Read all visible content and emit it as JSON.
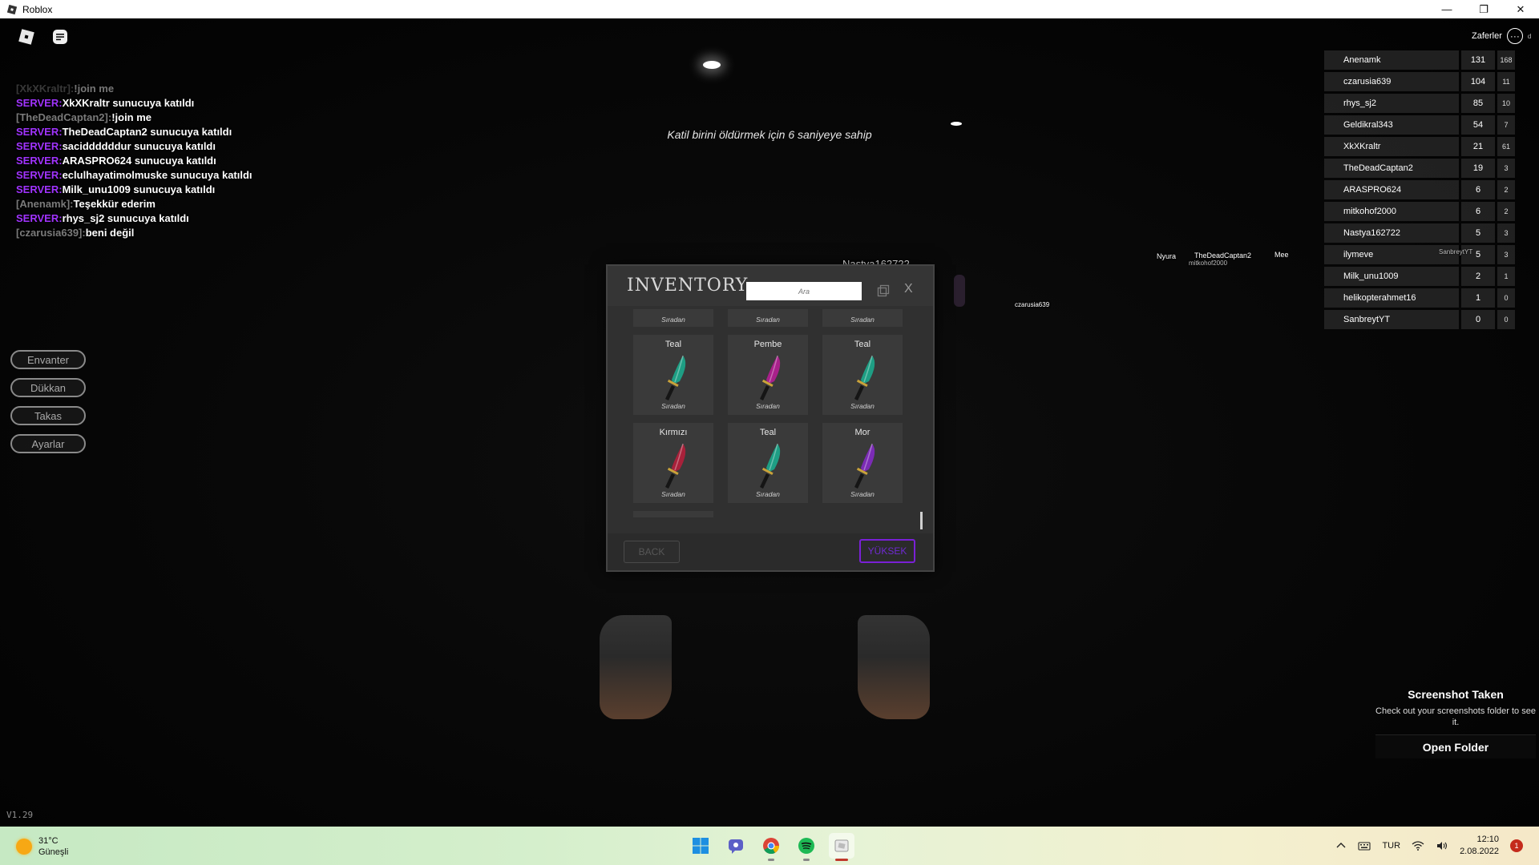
{
  "window": {
    "title": "Roblox",
    "minimize": "—",
    "restore": "❐",
    "close": "✕"
  },
  "game": {
    "countdown": "Katil birini öldürmek için 6 saniyeye sahip",
    "version": "V1.29"
  },
  "chat": [
    {
      "name": "[XkXKraltr]:",
      "msg": "!join me",
      "faded": true
    },
    {
      "server": "SERVER:",
      "msg": "XkXKraltr sunucuya katıldı"
    },
    {
      "name": "[TheDeadCaptan2]:",
      "msg": "!join me"
    },
    {
      "server": "SERVER:",
      "msg": "TheDeadCaptan2 sunucuya katıldı"
    },
    {
      "server": "SERVER:",
      "msg": "saciddddddur sunucuya katıldı"
    },
    {
      "server": "SERVER:",
      "msg": "ARASPRO624 sunucuya katıldı"
    },
    {
      "server": "SERVER:",
      "msg": "eclulhayatimolmuske sunucuya katıldı"
    },
    {
      "server": "SERVER:",
      "msg": "Milk_unu1009 sunucuya katıldı"
    },
    {
      "name": "[Anenamk]:",
      "msg": "Teşekkür ederim"
    },
    {
      "server": "SERVER:",
      "msg": "rhys_sj2 sunucuya katıldı"
    },
    {
      "name": "[czarusia639]:",
      "msg": "beni değil"
    }
  ],
  "side_menu": [
    "Envanter",
    "Dükkan",
    "Takas",
    "Ayarlar"
  ],
  "achievements": {
    "label": "Zaferler",
    "dots": "···",
    "small": "d"
  },
  "leaderboard": [
    {
      "name": "Anenamk",
      "score": "131",
      "extra": "168"
    },
    {
      "name": "czarusia639",
      "score": "104",
      "extra": "11"
    },
    {
      "name": "rhys_sj2",
      "score": "85",
      "extra": "10"
    },
    {
      "name": "Geldikral343",
      "score": "54",
      "extra": "7"
    },
    {
      "name": "XkXKraltr",
      "score": "21",
      "extra": "61"
    },
    {
      "name": "TheDeadCaptan2",
      "score": "19",
      "extra": "3"
    },
    {
      "name": "ARASPRO624",
      "score": "6",
      "extra": "2"
    },
    {
      "name": "mitkohof2000",
      "score": "6",
      "extra": "2"
    },
    {
      "name": "Nastya162722",
      "score": "5",
      "extra": "3"
    },
    {
      "name": "ilymeve",
      "score": "5",
      "extra": "3"
    },
    {
      "name": "Milk_unu1009",
      "score": "2",
      "extra": "1"
    },
    {
      "name": "helikopterahmet16",
      "score": "1",
      "extra": "0"
    },
    {
      "name": "SanbreytYT",
      "score": "0",
      "extra": "0"
    }
  ],
  "nametags": {
    "nastya": "Nastya162722",
    "nyura": "Nyura",
    "thedead": "TheDeadCaptan2",
    "mitko": "mitkohof2000",
    "mee": "Mee",
    "sanbreyt": "SanbreytYT",
    "czarusia": "czarusia639"
  },
  "inventory": {
    "title": "INVENTORY",
    "search_placeholder": "Ara",
    "close": "X",
    "top_rarities": [
      "Sıradan",
      "Sıradan",
      "Sıradan"
    ],
    "items": [
      {
        "name": "Teal",
        "rarity": "Sıradan",
        "color": "#1e9e84"
      },
      {
        "name": "Pembe",
        "rarity": "Sıradan",
        "color": "#a8208a"
      },
      {
        "name": "Teal",
        "rarity": "Sıradan",
        "color": "#1e9e84"
      },
      {
        "name": "Kırmızı",
        "rarity": "Sıradan",
        "color": "#a8213a"
      },
      {
        "name": "Teal",
        "rarity": "Sıradan",
        "color": "#1e9e84"
      },
      {
        "name": "Mor",
        "rarity": "Sıradan",
        "color": "#7b2bb5"
      }
    ],
    "back_label": "BACK",
    "upgrade_label": "YÜKSEK"
  },
  "toast": {
    "title": "Screenshot Taken",
    "body": "Check out your screenshots folder to see it.",
    "button": "Open Folder"
  },
  "taskbar": {
    "temp": "31°C",
    "condition": "Güneşli",
    "lang": "TUR",
    "time": "12:10",
    "date": "2.08.2022",
    "notifications": "1"
  }
}
